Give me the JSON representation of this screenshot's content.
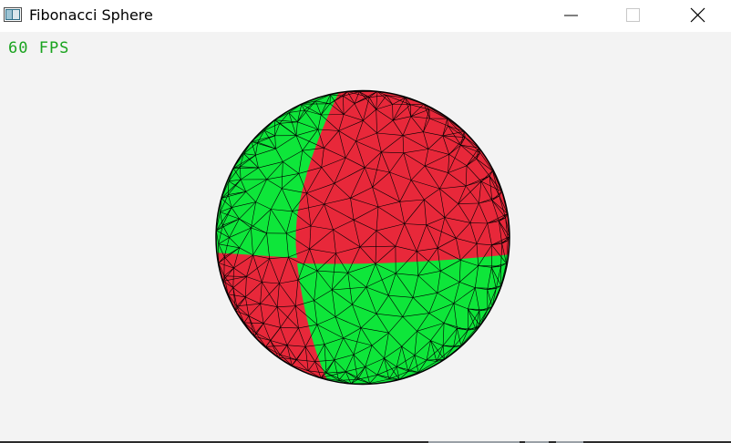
{
  "window": {
    "title": "Fibonacci Sphere",
    "icon": "app-window-icon"
  },
  "caption_buttons": {
    "minimize_icon": "minimize-icon",
    "maximize_icon": "maximize-icon",
    "close_icon": "close-icon"
  },
  "overlay": {
    "fps_text": "60 FPS",
    "fps_color": "#19a31e"
  },
  "sphere": {
    "colors": {
      "red": "#e8283a",
      "green": "#0ee63a",
      "wire": "#000000"
    }
  },
  "colors": {
    "titlebar_bg": "#ffffff",
    "canvas_bg": "#f3f3f3"
  }
}
